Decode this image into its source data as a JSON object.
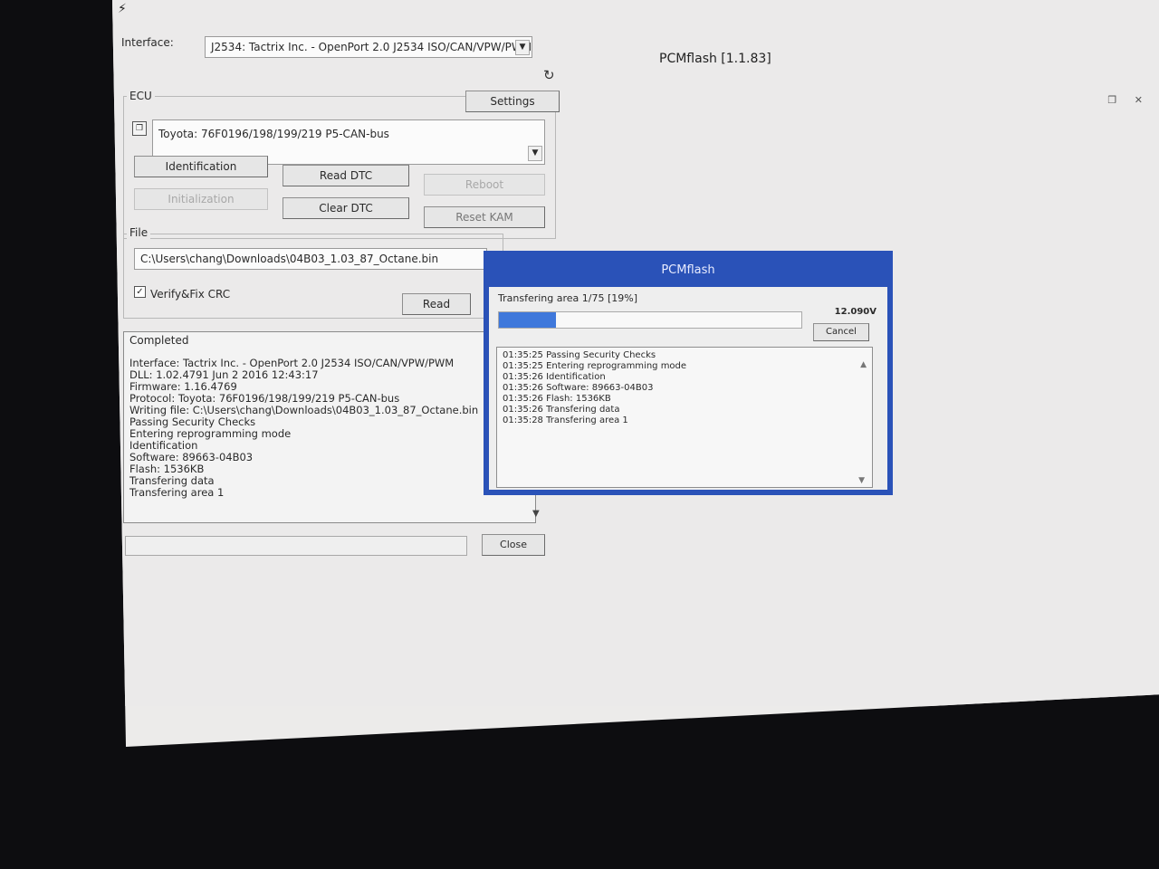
{
  "app": {
    "window_title": "PCMflash [1.1.83]",
    "titlebar_icon": "lightning-icon"
  },
  "interface": {
    "label": "Interface:",
    "selected": "J2534: Tactrix Inc. - OpenPort 2.0 J2534 ISO/CAN/VPW/PWM",
    "refresh_icon": "refresh-icon"
  },
  "ecu": {
    "group_title": "ECU",
    "settings_label": "Settings",
    "selected": "Toyota: 76F0196/198/199/219 P5-CAN-bus",
    "buttons": {
      "identification": "Identification",
      "read_dtc": "Read DTC",
      "reboot": "Reboot",
      "initialization": "Initialization",
      "clear_dtc": "Clear DTC",
      "reset_kam": "Reset KAM"
    }
  },
  "file": {
    "group_title": "File",
    "path": "C:\\Users\\chang\\Downloads\\04B03_1.03_87_Octane.bin",
    "verify_label": "Verify&Fix CRC",
    "verify_checked": true,
    "read_label": "Read"
  },
  "log": {
    "title": "Completed",
    "lines": [
      "Interface: Tactrix Inc. - OpenPort 2.0 J2534 ISO/CAN/VPW/PWM",
      "DLL: 1.02.4791 Jun  2 2016 12:43:17",
      "Firmware: 1.16.4769",
      "Protocol: Toyota: 76F0196/198/199/219 P5-CAN-bus",
      "Writing file: C:\\Users\\chang\\Downloads\\04B03_1.03_87_Octane.bin",
      "Passing Security Checks",
      "Entering reprogramming mode",
      "Identification",
      "Software: 89663-04B03",
      "Flash: 1536KB",
      "Transfering data",
      "Transfering area 1"
    ]
  },
  "close_label": "Close",
  "dialog": {
    "title": "PCMflash",
    "status": "Transfering area 1/75 [19%]",
    "progress_fraction": 0.19,
    "voltage": "12.090V",
    "cancel_label": "Cancel",
    "log_lines": [
      "01:35:25 Passing Security Checks",
      "01:35:25 Entering reprogramming mode",
      "01:35:26 Identification",
      "01:35:26 Software: 89663-04B03",
      "01:35:26 Flash: 1536KB",
      "01:35:26 Transfering data",
      "01:35:28 Transfering area 1"
    ]
  },
  "colors": {
    "dialog_frame": "#2a52b8",
    "progress_fill": "#3f78db"
  }
}
